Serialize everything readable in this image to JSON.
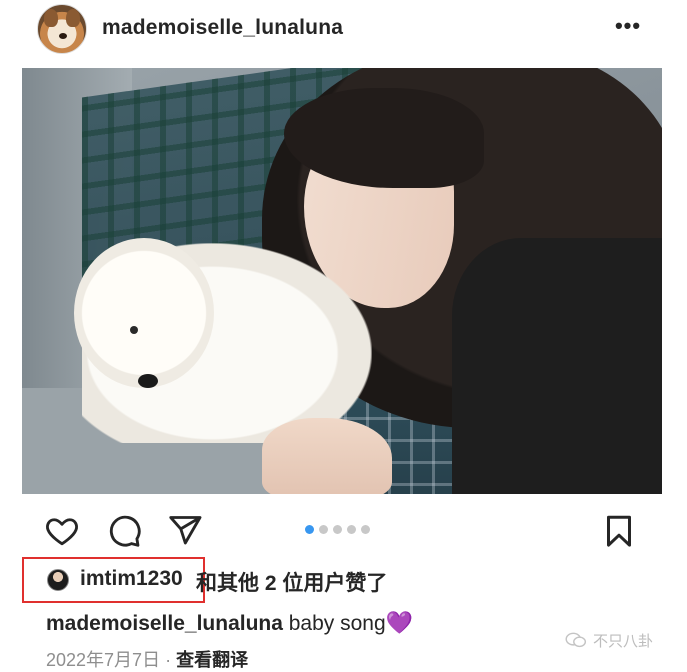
{
  "header": {
    "username": "mademoiselle_lunaluna",
    "more_icon": "more-horizontal-icon",
    "more_label": "•••"
  },
  "post": {
    "carousel": {
      "count": 5,
      "active_index": 0
    },
    "colors": {
      "accent": "#3897f0",
      "highlight": "#e0302e",
      "heart": "#9b4de0"
    }
  },
  "actions": {
    "like_icon": "heart-outline-icon",
    "comment_icon": "comment-bubble-icon",
    "share_icon": "paper-plane-icon",
    "save_icon": "bookmark-icon"
  },
  "likes": {
    "user": "imtim1230",
    "rest": "和其他 2 位用户赞了"
  },
  "caption": {
    "user": "mademoiselle_lunaluna",
    "text": " baby song",
    "emoji": "💜"
  },
  "meta": {
    "date": "2022年7月7日",
    "separator": " · ",
    "translate": "查看翻译"
  },
  "watermark": {
    "text": "不只八卦"
  }
}
